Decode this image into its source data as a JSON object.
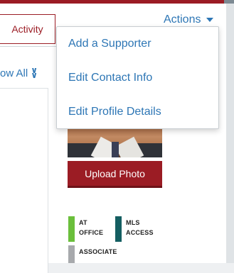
{
  "tabs": {
    "activity": "Activity"
  },
  "actions": {
    "label": "Actions",
    "menu": [
      "Add a Supporter",
      "Edit Contact Info",
      "Edit Profile Details"
    ]
  },
  "toggle": {
    "show_all": "ow All"
  },
  "profile": {
    "upload_button": "Upload Photo"
  },
  "badges": [
    {
      "line1": "AT",
      "line2": "OFFICE",
      "color": "#6abf3b"
    },
    {
      "line1": "MLS",
      "line2": "ACCESS",
      "color": "#145e61"
    },
    {
      "line1": "ASSOCIATE",
      "line2": "",
      "color": "#a7a9ac"
    }
  ],
  "colors": {
    "brand": "#9b1c24",
    "link": "#2d76b5"
  }
}
